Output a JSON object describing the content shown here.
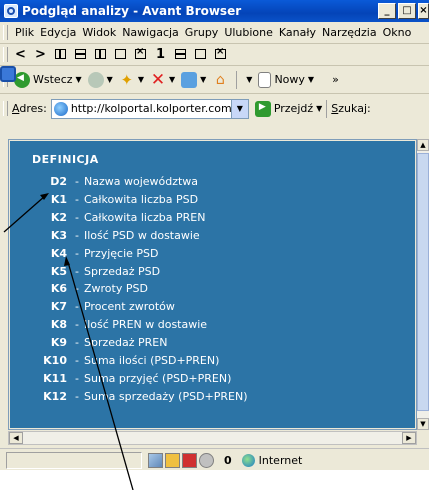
{
  "window": {
    "title": "Podgląd analizy - Avant Browser",
    "min_label": "_",
    "max_label": "□",
    "close_label": "×"
  },
  "menu": [
    "Plik",
    "Edycja",
    "Widok",
    "Nawigacja",
    "Grupy",
    "Ulubione",
    "Kanały",
    "Narzędzia",
    "Okno"
  ],
  "nav_glyphs": [
    "<",
    ">",
    "1"
  ],
  "toolbar": {
    "back_label": "Wstecz",
    "new_label": "Nowy",
    "more": "»"
  },
  "address": {
    "label_prefix": "A",
    "label_rest": "dres:",
    "url": "http://kolportal.kolporter.com.pl",
    "go_label": "Przejdź",
    "search_prefix": "S",
    "search_rest": "zukaj:"
  },
  "definitions": {
    "heading": "DEFINICJA",
    "separator": "-",
    "items": [
      {
        "code": "D2",
        "label": "Nazwa województwa"
      },
      {
        "code": "K1",
        "label": "Całkowita liczba PSD"
      },
      {
        "code": "K2",
        "label": "Całkowita liczba PREN"
      },
      {
        "code": "K3",
        "label": "Ilość PSD w dostawie"
      },
      {
        "code": "K4",
        "label": "Przyjęcie PSD"
      },
      {
        "code": "K5",
        "label": "Sprzedaż PSD"
      },
      {
        "code": "K6",
        "label": "Zwroty PSD"
      },
      {
        "code": "K7",
        "label": "Procent zwrotów"
      },
      {
        "code": "K8",
        "label": "Ilość PREN w dostawie"
      },
      {
        "code": "K9",
        "label": "Sprzedaż PREN"
      },
      {
        "code": "K10",
        "label": "Suma ilości (PSD+PREN)"
      },
      {
        "code": "K11",
        "label": "Suma przyjęć (PSD+PREN)"
      },
      {
        "code": "K12",
        "label": "Suma sprzedaży (PSD+PREN)"
      }
    ]
  },
  "status": {
    "count": "0",
    "zone": "Internet"
  },
  "colors": {
    "content_bg": "#2c74a6",
    "title_bar": "#0a52c8"
  }
}
